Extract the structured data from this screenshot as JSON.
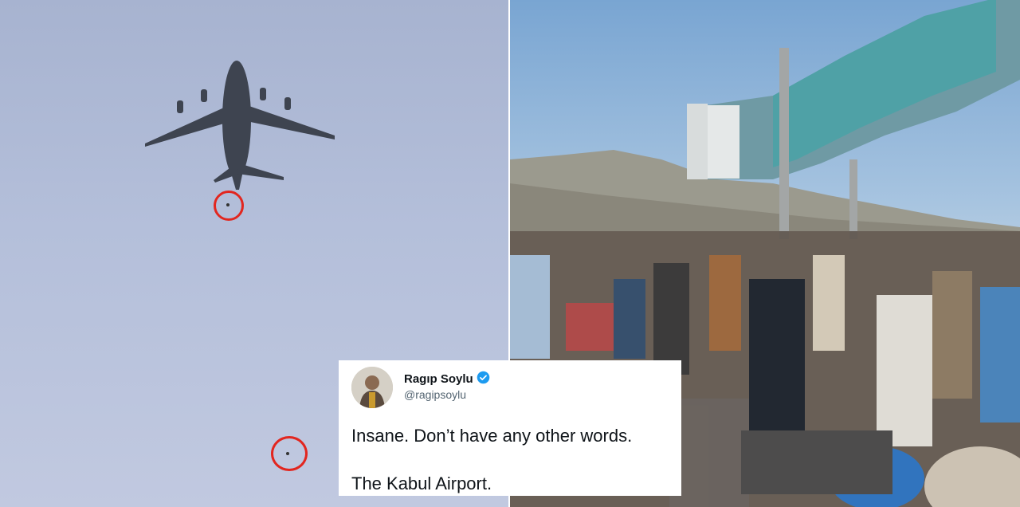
{
  "tweet": {
    "name": "Ragıp Soylu",
    "handle": "@ragipsoylu",
    "verified": true,
    "text_line1": "Insane. Don’t have any other words.",
    "text_line2": "The Kabul Airport."
  },
  "images": {
    "left": "military-cargo-plane-in-sky-with-circled-falling-figures",
    "right": "crowd-on-airport-tarmac-under-jet-bridge-with-mountains"
  },
  "colors": {
    "highlight_circle": "#e2261f",
    "verified_badge": "#1d9bf0"
  }
}
